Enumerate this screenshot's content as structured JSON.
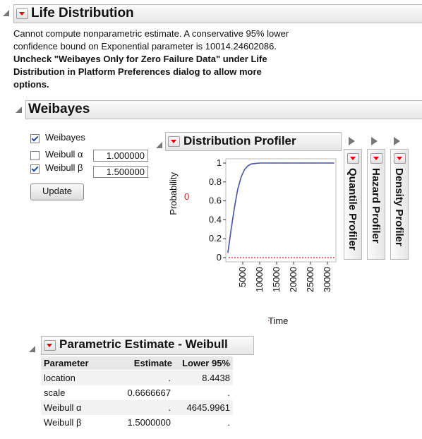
{
  "life_distribution": {
    "title": "Life Distribution",
    "message_line1": "Cannot compute nonparametric estimate. A conservative 95% lower",
    "message_line2": "confidence bound on Exponential parameter is 10014.24602086.",
    "bold_line1": "Uncheck \"Weibayes Only for Zero Failure Data\" under Life",
    "bold_line2": "Distribution in Platform Preferences dialog to allow more",
    "bold_line3": "options."
  },
  "weibayes": {
    "title": "Weibayes",
    "checkbox_weibayes": {
      "label": "Weibayes",
      "checked": true
    },
    "alpha": {
      "label": "Weibull α",
      "checked": false,
      "value": "1.000000"
    },
    "beta": {
      "label": "Weibull β",
      "checked": true,
      "value": "1.500000"
    },
    "update_label": "Update"
  },
  "profiler": {
    "title": "Distribution Profiler",
    "y_axis_label": "Probability",
    "y_current_value": "0",
    "x_axis_label": "Time",
    "x_current_value": ".",
    "quantile_title": "Quantile Profiler",
    "hazard_title": "Hazard Profiler",
    "density_title": "Density Profiler"
  },
  "chart_data": {
    "type": "line",
    "title": "Distribution Profiler",
    "xlabel": "Time",
    "ylabel": "Probability",
    "x_ticks": [
      "5000",
      "10000",
      "15000",
      "20000",
      "25000",
      "30000"
    ],
    "y_ticks": [
      "0",
      "0.2",
      "0.4",
      "0.6",
      "0.8",
      "1"
    ],
    "xlim": [
      0,
      32500
    ],
    "ylim": [
      0,
      1
    ],
    "series": [
      {
        "color": "#2b56c4",
        "x": [
          600,
          1500,
          2500,
          3500,
          4500,
          5500,
          6500,
          7500,
          8500,
          10000,
          12000,
          15000,
          20000,
          25000,
          32000
        ],
        "y": [
          0.05,
          0.28,
          0.52,
          0.72,
          0.85,
          0.93,
          0.97,
          0.99,
          0.995,
          1.0,
          1.0,
          1.0,
          1.0,
          1.0,
          1.0
        ]
      }
    ],
    "reference_line": {
      "y": 0,
      "color": "#d02020"
    }
  },
  "parametric": {
    "title": "Parametric Estimate - Weibull",
    "columns": [
      "Parameter",
      "Estimate",
      "Lower 95%"
    ],
    "rows": [
      [
        "location",
        ".",
        "8.4438"
      ],
      [
        "scale",
        "0.6666667",
        "."
      ],
      [
        "Weibull α",
        ".",
        "4645.9961"
      ],
      [
        "Weibull β",
        "1.5000000",
        "."
      ]
    ]
  }
}
